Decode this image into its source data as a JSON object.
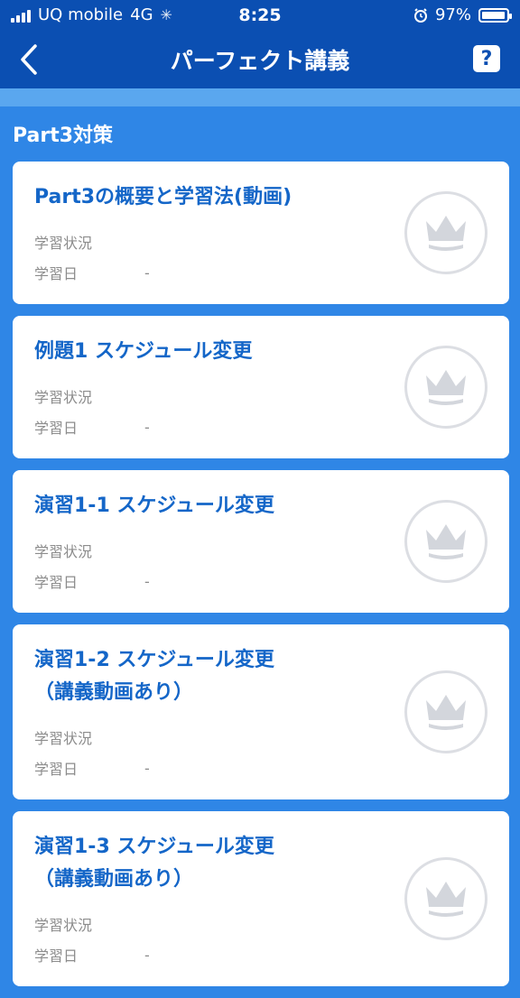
{
  "status": {
    "carrier": "UQ mobile",
    "network": "4G",
    "time": "8:25",
    "battery": "97%",
    "battery_level": 0.97
  },
  "nav": {
    "title": "パーフェクト講義",
    "help": "?"
  },
  "section": {
    "title": "Part3対策"
  },
  "colors": {
    "nav_bg": "#0b4fb2",
    "page_bg": "#2f86e6",
    "title_blue": "#1466c8",
    "crown_gray": "#d3d6dc"
  },
  "lessons": [
    {
      "title": "Part3の概要と学習法(動画)",
      "status_label": "学習状況",
      "status_value": "",
      "date_label": "学習日",
      "date_value": "-",
      "icon": "crown-icon"
    },
    {
      "title": "例題1 スケジュール変更",
      "status_label": "学習状況",
      "status_value": "",
      "date_label": "学習日",
      "date_value": "-",
      "icon": "crown-icon"
    },
    {
      "title": "演習1-1 スケジュール変更",
      "status_label": "学習状況",
      "status_value": "",
      "date_label": "学習日",
      "date_value": "-",
      "icon": "crown-icon"
    },
    {
      "title": "演習1-2 スケジュール変更\n（講義動画あり）",
      "status_label": "学習状況",
      "status_value": "",
      "date_label": "学習日",
      "date_value": "-",
      "icon": "crown-icon"
    },
    {
      "title": "演習1-3 スケジュール変更\n（講義動画あり）",
      "status_label": "学習状況",
      "status_value": "",
      "date_label": "学習日",
      "date_value": "-",
      "icon": "crown-icon"
    }
  ]
}
